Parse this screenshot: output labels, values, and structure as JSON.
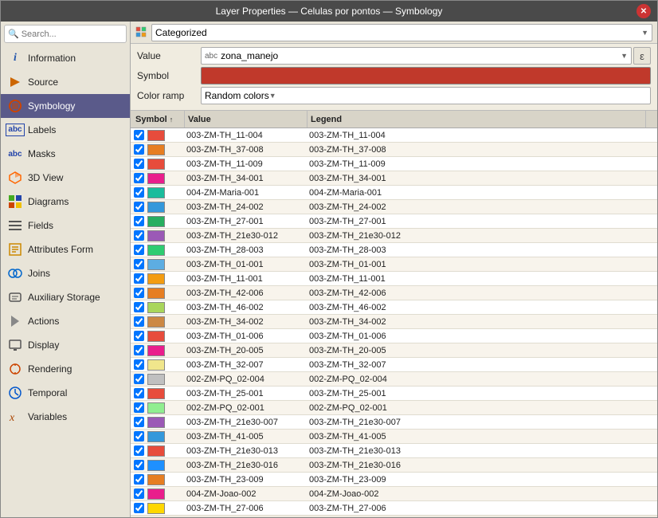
{
  "window": {
    "title": "Layer Properties — Celulas por pontos — Symbology",
    "close_label": "✕"
  },
  "toolbar": {
    "categorized_label": "Categorized",
    "dropdown_arrow": "▼"
  },
  "form": {
    "value_label": "Value",
    "value_type": "abc",
    "value_text": "zona_manejo",
    "expr_button": "ε",
    "symbol_label": "Symbol",
    "color_ramp_label": "Color ramp",
    "color_ramp_value": "Random colors"
  },
  "table": {
    "headers": [
      {
        "label": "Symbol",
        "sort": "↑"
      },
      {
        "label": "Value",
        "sort": ""
      },
      {
        "label": "Legend",
        "sort": ""
      }
    ],
    "rows": [
      {
        "color": "#e74c3c",
        "value": "003-ZM-TH_11-004",
        "legend": "003-ZM-TH_11-004"
      },
      {
        "color": "#e67e22",
        "value": "003-ZM-TH_37-008",
        "legend": "003-ZM-TH_37-008"
      },
      {
        "color": "#e74c3c",
        "value": "003-ZM-TH_11-009",
        "legend": "003-ZM-TH_11-009"
      },
      {
        "color": "#e91e8c",
        "value": "003-ZM-TH_34-001",
        "legend": "003-ZM-TH_34-001"
      },
      {
        "color": "#1abc9c",
        "value": "004-ZM-Maria-001",
        "legend": "004-ZM-Maria-001"
      },
      {
        "color": "#3498db",
        "value": "003-ZM-TH_24-002",
        "legend": "003-ZM-TH_24-002"
      },
      {
        "color": "#27ae60",
        "value": "003-ZM-TH_27-001",
        "legend": "003-ZM-TH_27-001"
      },
      {
        "color": "#9b59b6",
        "value": "003-ZM-TH_21e30-012",
        "legend": "003-ZM-TH_21e30-012"
      },
      {
        "color": "#2ecc71",
        "value": "003-ZM-TH_28-003",
        "legend": "003-ZM-TH_28-003"
      },
      {
        "color": "#5dade2",
        "value": "003-ZM-TH_01-001",
        "legend": "003-ZM-TH_01-001"
      },
      {
        "color": "#f39c12",
        "value": "003-ZM-TH_11-001",
        "legend": "003-ZM-TH_11-001"
      },
      {
        "color": "#e67e22",
        "value": "003-ZM-TH_42-006",
        "legend": "003-ZM-TH_42-006"
      },
      {
        "color": "#a9d65c",
        "value": "003-ZM-TH_46-002",
        "legend": "003-ZM-TH_46-002"
      },
      {
        "color": "#cc8844",
        "value": "003-ZM-TH_34-002",
        "legend": "003-ZM-TH_34-002"
      },
      {
        "color": "#e74c3c",
        "value": "003-ZM-TH_01-006",
        "legend": "003-ZM-TH_01-006"
      },
      {
        "color": "#e91e8c",
        "value": "003-ZM-TH_20-005",
        "legend": "003-ZM-TH_20-005"
      },
      {
        "color": "#f0e68c",
        "value": "003-ZM-TH_32-007",
        "legend": "003-ZM-TH_32-007"
      },
      {
        "color": "#c0c0c0",
        "value": "002-ZM-PQ_02-004",
        "legend": "002-ZM-PQ_02-004"
      },
      {
        "color": "#e74c3c",
        "value": "003-ZM-TH_25-001",
        "legend": "003-ZM-TH_25-001"
      },
      {
        "color": "#90ee90",
        "value": "002-ZM-PQ_02-001",
        "legend": "002-ZM-PQ_02-001"
      },
      {
        "color": "#9b59b6",
        "value": "003-ZM-TH_21e30-007",
        "legend": "003-ZM-TH_21e30-007"
      },
      {
        "color": "#3498db",
        "value": "003-ZM-TH_41-005",
        "legend": "003-ZM-TH_41-005"
      },
      {
        "color": "#e74c3c",
        "value": "003-ZM-TH_21e30-013",
        "legend": "003-ZM-TH_21e30-013"
      },
      {
        "color": "#1e90ff",
        "value": "003-ZM-TH_21e30-016",
        "legend": "003-ZM-TH_21e30-016"
      },
      {
        "color": "#e67e22",
        "value": "003-ZM-TH_23-009",
        "legend": "003-ZM-TH_23-009"
      },
      {
        "color": "#e91e8c",
        "value": "004-ZM-Joao-002",
        "legend": "004-ZM-Joao-002"
      },
      {
        "color": "#ffd700",
        "value": "003-ZM-TH_27-006",
        "legend": "003-ZM-TH_27-006"
      }
    ]
  },
  "sidebar": {
    "search_placeholder": "Search...",
    "items": [
      {
        "id": "information",
        "label": "Information",
        "icon": "info"
      },
      {
        "id": "source",
        "label": "Source",
        "icon": "source"
      },
      {
        "id": "symbology",
        "label": "Symbology",
        "icon": "symbology",
        "active": true
      },
      {
        "id": "labels",
        "label": "Labels",
        "icon": "labels"
      },
      {
        "id": "masks",
        "label": "Masks",
        "icon": "masks"
      },
      {
        "id": "3dview",
        "label": "3D View",
        "icon": "3dview"
      },
      {
        "id": "diagrams",
        "label": "Diagrams",
        "icon": "diagrams"
      },
      {
        "id": "fields",
        "label": "Fields",
        "icon": "fields"
      },
      {
        "id": "attributes-form",
        "label": "Attributes Form",
        "icon": "attrform"
      },
      {
        "id": "joins",
        "label": "Joins",
        "icon": "joins"
      },
      {
        "id": "auxiliary-storage",
        "label": "Auxiliary Storage",
        "icon": "aux"
      },
      {
        "id": "actions",
        "label": "Actions",
        "icon": "actions"
      },
      {
        "id": "display",
        "label": "Display",
        "icon": "display"
      },
      {
        "id": "rendering",
        "label": "Rendering",
        "icon": "rendering"
      },
      {
        "id": "temporal",
        "label": "Temporal",
        "icon": "temporal"
      },
      {
        "id": "variables",
        "label": "Variables",
        "icon": "variables"
      }
    ]
  }
}
